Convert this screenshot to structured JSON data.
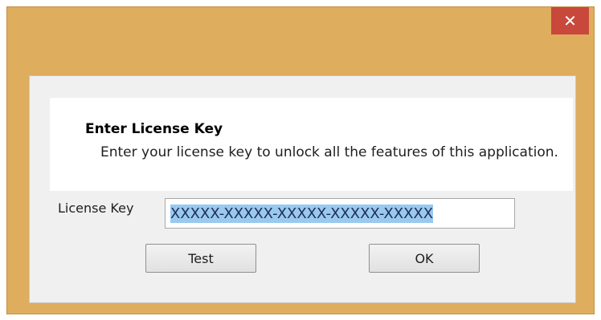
{
  "window": {
    "close_glyph": "✕"
  },
  "dialog": {
    "heading": "Enter License Key",
    "description": "Enter your license key to unlock all the features of this application.",
    "key_label": "License Key",
    "key_value": "XXXXX-XXXXX-XXXXX-XXXXX-XXXXX",
    "test_button": "Test",
    "ok_button": "OK"
  },
  "colors": {
    "frame": "#dfad5e",
    "close_button": "#c8483c",
    "selection": "#99c9ef"
  },
  "icons": {
    "close": "close-icon"
  }
}
